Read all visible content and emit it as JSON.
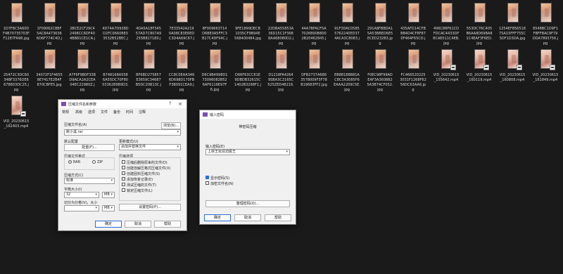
{
  "tiles_row1": [
    {
      "name": "1D7F8C5A60DF4B70735703FF1287FA98.jpg",
      "video": false
    },
    {
      "name": "1F09062C8BF5AC8A4736366D6F774C4D.jpg",
      "video": false
    },
    {
      "name": "2BCE2CF29C42498CC6DF404BB81CE1CA.jpg",
      "video": false
    },
    {
      "name": "4D74A7D938DD2FC06608833532B52BEC.jpg",
      "video": false
    },
    {
      "name": "4DA5A18F34557AD7C807A9255B817180.jpg",
      "video": false
    },
    {
      "name": "7E33542A2190A08C83E6EDC3D4A69C67.jpg",
      "video": false
    },
    {
      "name": "8F009663714D6BE0A5FFC3B17C4DF94C.jpg",
      "video": false
    },
    {
      "name": "9FE1899DECB1035CF9B94E568400484.jpg",
      "video": false
    },
    {
      "name": "22DBA55853A36D15C1F3688AA68080D2.jpg",
      "video": false
    },
    {
      "name": "44A7BFACF5A7026B90B8002B20462845.jpg",
      "video": false
    },
    {
      "name": "91F3DAC05855762240ED374ACA3C8083.jpg",
      "video": false
    },
    {
      "name": "291A8FBBDA15A53BBED6E5ECED232B3.jpg",
      "video": false
    },
    {
      "name": "435AFD14CFBBB4D4CF8F870F464F65CD.jpg",
      "video": false
    },
    {
      "name": "496C86F61CDFDCAC4433DF8CAE011C4EB.jpg",
      "video": false
    },
    {
      "name": "553DC76C405B6AA8D69BA81C4EAF3F6ED.jpg",
      "video": false
    },
    {
      "name": "1254EF8565187SA15FFF755C5DF1D3DA.jpg",
      "video": false
    },
    {
      "name": "6548BC1D9F1FBFFBAC9F79DDA7893756.jpg",
      "video": false
    }
  ],
  "tiles_row2": [
    {
      "name": "25472C3DC6034BF3376DE6678803DC25.jpg",
      "video": false
    },
    {
      "name": "34072F1F46559E7417E2B4F870CBFE5.jpg",
      "video": false
    },
    {
      "name": "A7F6F9B0F33BD9ACA2A2CEA04EC22980Z.jpg",
      "video": false
    },
    {
      "name": "B748168A5586A55DC70F800336289B9D3.jpg",
      "video": false
    },
    {
      "name": "BF6BD275857E3659C34687B5DC20B13C.jpg",
      "video": false
    },
    {
      "name": "CC8C0EAA3466D698D170FBF3B091CEA9.jpg",
      "video": false
    },
    {
      "name": "D6C9B4998D173096082B526AF6116E97F6.jpg",
      "video": false
    },
    {
      "name": "D66F63CC61E9DBDB32615C1402B3298F1.jpg",
      "video": false
    },
    {
      "name": "D1218FA42649SBA3C2165C525ZED48216.jpg",
      "video": false
    },
    {
      "name": "DFB2737A6883578009F3F78B19683FF2.jpg",
      "video": false
    },
    {
      "name": "EB8818B881AC8C3A3085F6EAAA2209C5E.jpg",
      "video": false
    },
    {
      "name": "F0EC98F99ADEAF3A3608B25A3B74CF052.jpg",
      "video": false
    },
    {
      "name": "FC4665202253031F1268F6256DC63AA6.jpg",
      "video": false
    },
    {
      "name": "VID_20230615_155642.mp4",
      "video": true
    },
    {
      "name": "VID_20230615_160119.mp4",
      "video": true
    },
    {
      "name": "VID_20230615_160808.mp4",
      "video": true
    },
    {
      "name": "VID_20230615_161849.mp4",
      "video": true
    }
  ],
  "tiles_row3": [
    {
      "name": "VID_20230615_162403.mp4",
      "video": true
    }
  ],
  "archive_dialog": {
    "title": "压缩文件名和参数",
    "help_glyph": "?",
    "close_glyph": "×",
    "tabs": [
      "常规",
      "高级",
      "选项",
      "文件",
      "备份",
      "时间",
      "注释"
    ],
    "archive_name_label": "压缩文件名(A)",
    "archive_name_value": "账小溪.rar",
    "browse_label": "浏览(B)...",
    "default_config_label": "默认配置",
    "profiles_label": "配置(F)...",
    "update_mode_label": "更新模式(U)",
    "update_mode_value": "添加并替换文件",
    "format_group": "压缩文件格式",
    "format_rar": "RAR",
    "format_zip": "ZIP",
    "method_label": "压缩方式(C)",
    "method_value": "标准",
    "dict_label": "字典大小(I)",
    "dict_value": "32",
    "dict_unit": "MB",
    "split_label": "切分为分卷(V)，大小",
    "split_unit": "MB",
    "options_group": "压缩选项",
    "options": [
      {
        "label": "压缩后删除原来的文件(D)",
        "checked": false
      },
      {
        "label": "创建自解压格式压缩文件(X)",
        "checked": false
      },
      {
        "label": "创建固实压缩文件(S)",
        "checked": false
      },
      {
        "label": "添加恢复记录(E)",
        "checked": false
      },
      {
        "label": "测试压缩的文件(T)",
        "checked": false
      },
      {
        "label": "锁定压缩文件(L)",
        "checked": false
      }
    ],
    "set_password_label": "设置密码(P)...",
    "ok_label": "确定",
    "cancel_label": "取消",
    "help_label": "帮助"
  },
  "password_dialog": {
    "title": "输入密码",
    "subtitle": "带密码压缩",
    "password_label": "输入密码(E)",
    "password_value": "上岸王玩炫迈姬王",
    "show_password_label": "显示密码(S)",
    "show_password_checked": true,
    "encrypt_names_label": "加密文件名(N)",
    "encrypt_names_checked": false,
    "organize_label": "整理密码(O)...",
    "ok_label": "确定",
    "cancel_label": "取消",
    "help_label": "帮助"
  }
}
